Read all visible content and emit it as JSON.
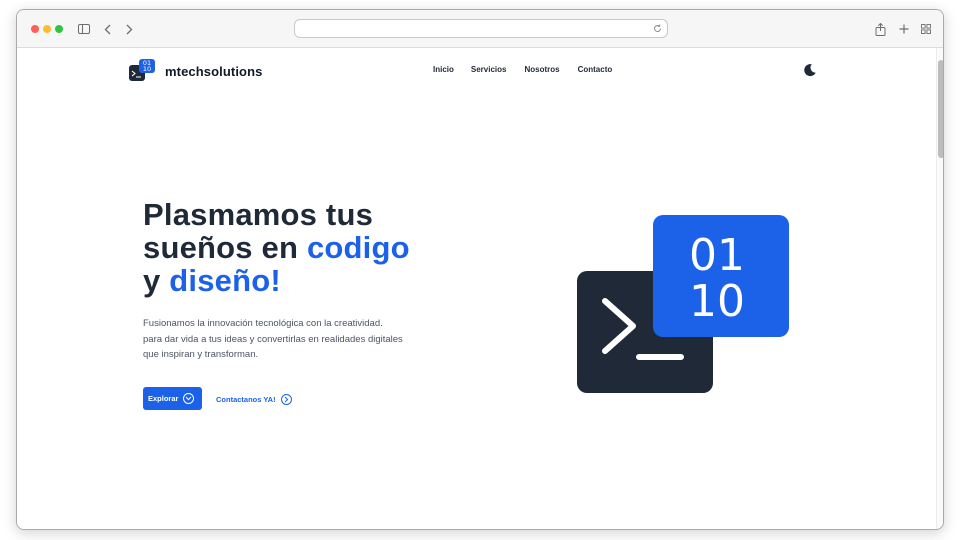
{
  "browser": {
    "url": ""
  },
  "site": {
    "logo_mark_top": "01",
    "logo_mark_bottom": "10",
    "brand": "mtechsolutions"
  },
  "nav": {
    "items": [
      "Inicio",
      "Servicios",
      "Nosotros",
      "Contacto"
    ]
  },
  "hero": {
    "line1": "Plasmamos tus",
    "line2_plain": "sueños en ",
    "line2_accent": "codigo",
    "line3_plain": "y ",
    "line3_accent": "diseño!",
    "description": [
      "Fusionamos la innovación tecnológica con la creatividad.",
      "para dar vida a tus ideas y convertirlas en realidades digitales",
      "que inspiran y transforman."
    ],
    "primary_button": "Explorar",
    "secondary_button": "Contactanos YA!"
  },
  "illustration": {
    "top_digits": "01",
    "bottom_digits": "10"
  },
  "colors": {
    "accent": "#1c62e8",
    "dark": "#1f2937"
  }
}
